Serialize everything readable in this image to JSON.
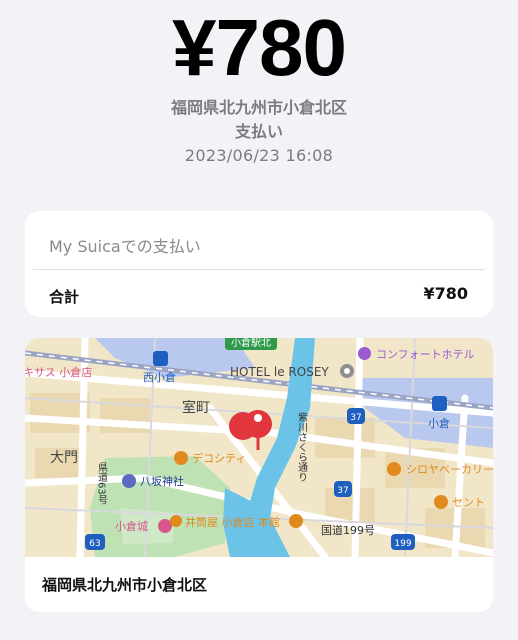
{
  "payment": {
    "amount": "¥780",
    "location": "福岡県北九州市小倉北区",
    "type": "支払い",
    "datetime": "2023/06/23 16:08"
  },
  "summary": {
    "title": "My Suicaでの支払い",
    "total_label": "合計",
    "total_value": "¥780"
  },
  "map": {
    "labels": {
      "kokura_kita_station": "小倉駅北",
      "comfort_hotel": "コンフォートホテル",
      "kitasasu": "キサス 小倉店",
      "nishikokura": "西小倉",
      "hotel_rosey": "HOTEL le ROSEY",
      "muromachi": "室町",
      "murasaki_street": "紫川さくら通り",
      "kokura": "小倉",
      "omon": "大門",
      "decocity": "デコシティ",
      "shiroya": "シロヤベーカリー",
      "pref_road": "県道63号",
      "yasaka": "八坂神社",
      "center": "セント",
      "kokura_castle": "小倉城",
      "izutsuya": "井筒屋 小倉店 本館",
      "route199": "国道199号",
      "shield_37a": "37",
      "shield_37b": "37",
      "shield_63": "63",
      "shield_199": "199"
    },
    "place_name": "福岡県北九州市小倉北区"
  },
  "colors": {
    "background": "#f2f2f7",
    "card": "#ffffff",
    "secondary_text": "#7b7b80",
    "pin": "#e2363d",
    "river": "#6cc3e8",
    "transit_label": "#1f5fbf",
    "poi_orange": "#e08a1e",
    "poi_pink": "#d8578a",
    "poi_purple": "#9a5bd0"
  }
}
